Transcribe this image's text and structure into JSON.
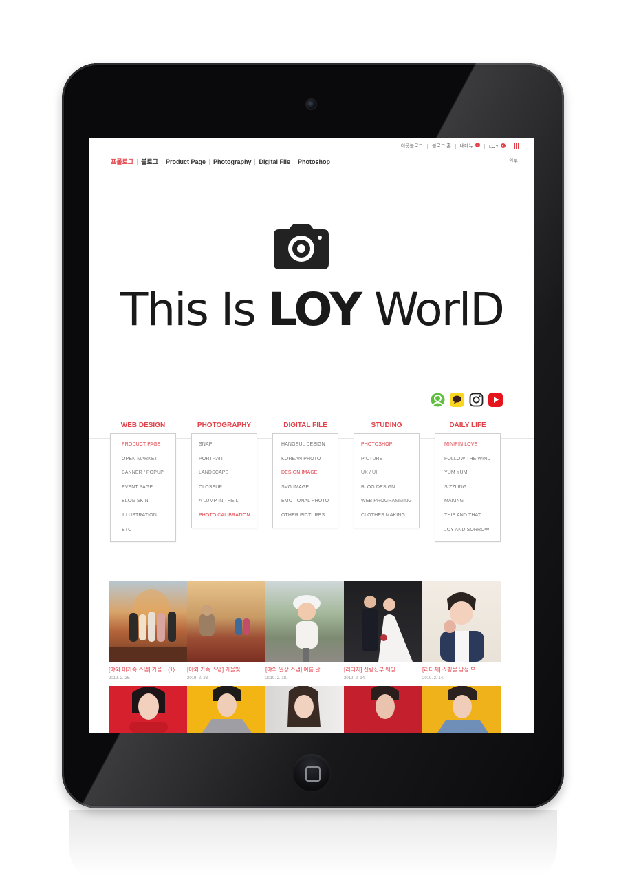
{
  "top_util": {
    "neighbor": "이웃블로그",
    "blog_home": "블로그 홈",
    "my_menu": "내메뉴",
    "user": "LOY"
  },
  "gnb": {
    "items": [
      "프롤로그",
      "블로그",
      "Product Page",
      "Photography",
      "Digital File",
      "Photoshop"
    ],
    "guide": "안부"
  },
  "hero": {
    "title_light": "This Is ",
    "title_bold": "LOY",
    "title_end": " WorlD"
  },
  "sns": [
    "profile-icon",
    "kakao-talk-icon",
    "instagram-icon",
    "youtube-icon"
  ],
  "categories": [
    {
      "title": "WEB DESIGN",
      "items": [
        "PRODUCT PAGE",
        "OPEN MARKET",
        "BANNER / POPUP",
        "EVENT PAGE",
        "BLOG SKIN",
        "ILLUSTRATION",
        "ETC"
      ]
    },
    {
      "title": "PHOTOGRAPHY",
      "items": [
        "SNAP",
        "PORTRAIT",
        "LANDSCAPE",
        "CLOSEUP",
        "A LUMP IN THE LI",
        "PHOTO CALIBRATION"
      ]
    },
    {
      "title": "DIGITAL FILE",
      "items": [
        "HANGEUL DESIGN",
        "KOREAN PHOTO",
        "DESIGN IMAGE",
        "SVG IMAGE",
        "EMOTIONAL PHOTO",
        "OTHER PICTURES"
      ]
    },
    {
      "title": "STUDING",
      "items": [
        "PHOTOSHOP",
        "PICTURE",
        "UX / UI",
        "BLOG DESIGN",
        "WEB PROGRAMMING",
        "CLOTHES MAKING"
      ]
    },
    {
      "title": "DAILY LIFE",
      "items": [
        "MINIPIN LOVE",
        "FOLLOW THE WIND",
        "YUM YUM",
        "SIZZLING",
        "MAKING",
        "THIS AND THAT",
        "JOY AND SORROW"
      ]
    }
  ],
  "posts": [
    {
      "title": "[야외 대가족 스냅] 가을... (1)",
      "date": "2019. 2. 26."
    },
    {
      "title": "[야외 가족 스냅] 가을빛...",
      "date": "2019. 2. 23."
    },
    {
      "title": "[야외 일상 스냅] 여름 날 ...",
      "date": "2019. 2. 18."
    },
    {
      "title": "[리터치] 신랑신부 웨딩...",
      "date": "2019. 2. 14."
    },
    {
      "title": "[리터치] 쇼핑몰 남성 모...",
      "date": "2019. 2. 14."
    }
  ],
  "colors": {
    "accent": "#e2424a",
    "text": "#333333",
    "muted": "#777777"
  }
}
